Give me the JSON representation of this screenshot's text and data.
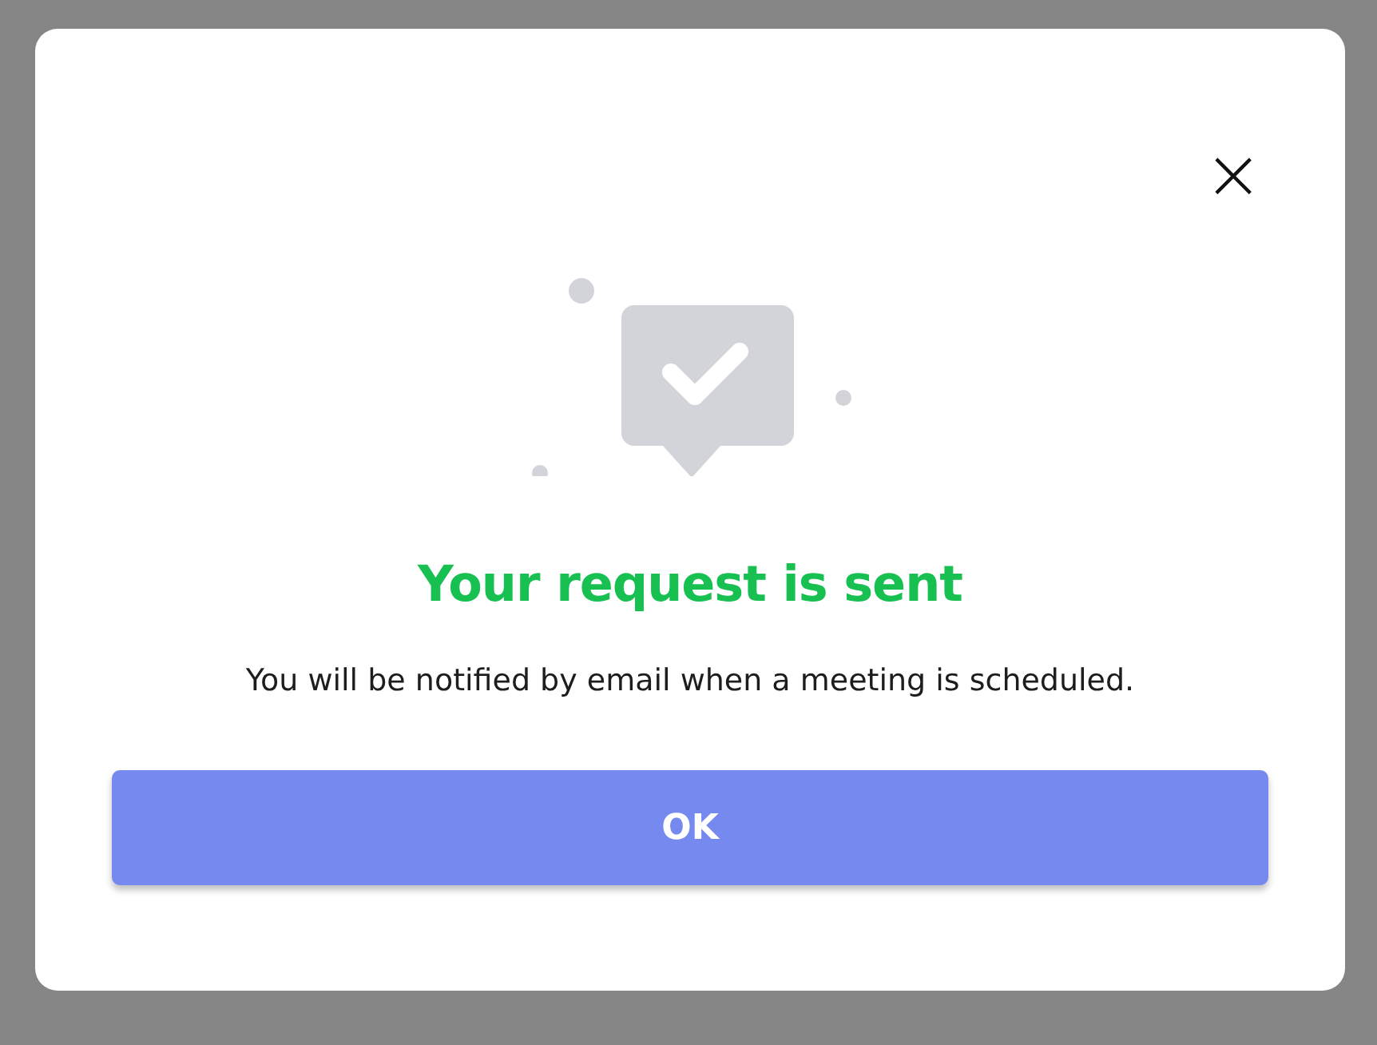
{
  "dialog": {
    "close": "×",
    "title": "Your request is sent",
    "message": "You will be notified by email when a meeting is scheduled.",
    "button": "OK"
  }
}
